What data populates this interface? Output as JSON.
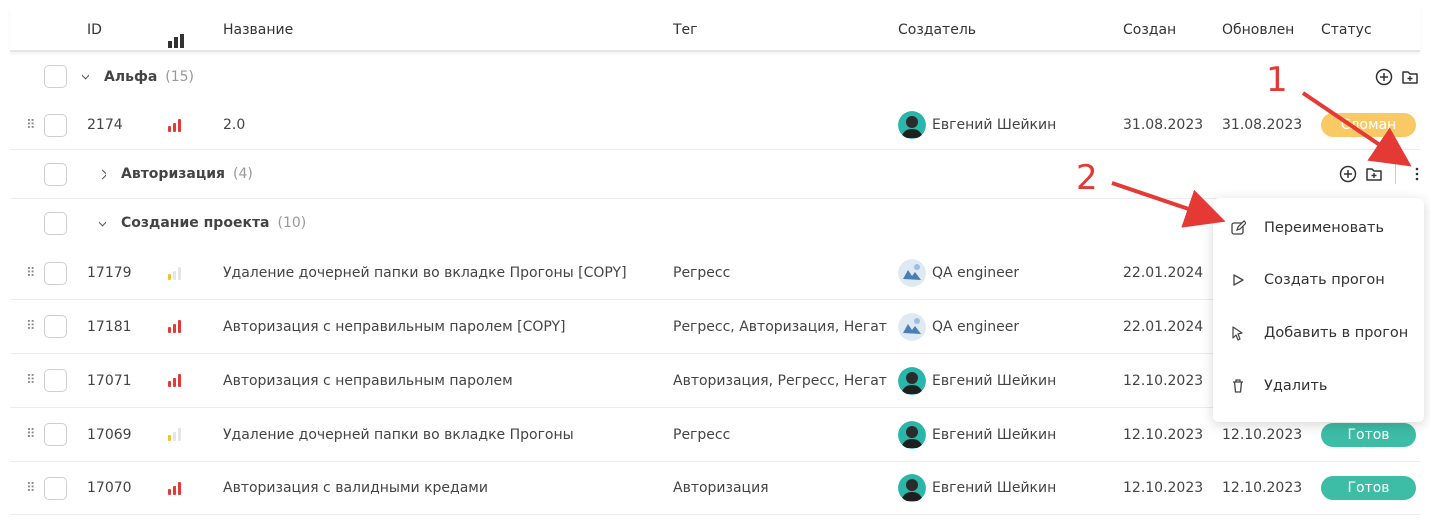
{
  "header": {
    "id": "ID",
    "priority_icon": "bar-chart-icon",
    "name": "Название",
    "tag": "Тег",
    "creator": "Создатель",
    "created": "Создан",
    "updated": "Обновлен",
    "status": "Статус"
  },
  "groups": {
    "alpha": {
      "name": "Альфа",
      "count": "(15)"
    },
    "auth": {
      "name": "Авторизация",
      "count": "(4)"
    },
    "project": {
      "name": "Создание проекта",
      "count": "(10)"
    }
  },
  "rows": [
    {
      "id": "2174",
      "name": "2.0",
      "tag": "",
      "creator": "Евгений Шейкин",
      "created": "31.08.2023",
      "updated": "31.08.2023",
      "status": "Сломан",
      "priority_level": 3,
      "priority_color": "#e53935"
    },
    {
      "id": "17179",
      "name": "Удаление дочерней папки во вкладке Прогоны [COPY]",
      "tag": "Регресс",
      "creator": "QA engineer",
      "created": "22.01.2024",
      "updated": "",
      "status": "",
      "priority_level": 1,
      "priority_color": "#f2c12e"
    },
    {
      "id": "17181",
      "name": "Авторизация с неправильным паролем [COPY]",
      "tag": "Регресс, Авторизация, Негат...",
      "creator": "QA engineer",
      "created": "22.01.2024",
      "updated": "",
      "status": "",
      "priority_level": 3,
      "priority_color": "#e53935"
    },
    {
      "id": "17071",
      "name": "Авторизация с неправильным паролем",
      "tag": "Авторизация, Регресс, Негат...",
      "creator": "Евгений Шейкин",
      "created": "12.10.2023",
      "updated": "",
      "status": "",
      "priority_level": 3,
      "priority_color": "#e53935"
    },
    {
      "id": "17069",
      "name": "Удаление дочерней папки во вкладке Прогоны",
      "tag": "Регресс",
      "creator": "Евгений Шейкин",
      "created": "12.10.2023",
      "updated": "12.10.2023",
      "status": "Готов",
      "priority_level": 1,
      "priority_color": "#f2c12e"
    },
    {
      "id": "17070",
      "name": "Авторизация с валидными кредами",
      "tag": "Авторизация",
      "creator": "Евгений Шейкин",
      "created": "12.10.2023",
      "updated": "12.10.2023",
      "status": "Готов",
      "priority_level": 3,
      "priority_color": "#e53935"
    }
  ],
  "status_colors": {
    "broken": "#f9c966",
    "ready": "#3dbda6"
  },
  "context_menu": {
    "items": [
      {
        "label": "Переименовать",
        "icon": "edit-icon"
      },
      {
        "label": "Создать прогон",
        "icon": "play-icon"
      },
      {
        "label": "Добавить в прогон",
        "icon": "pointer-icon"
      },
      {
        "label": "Удалить",
        "icon": "trash-icon"
      }
    ]
  },
  "annotations": {
    "one": "1",
    "two": "2"
  }
}
